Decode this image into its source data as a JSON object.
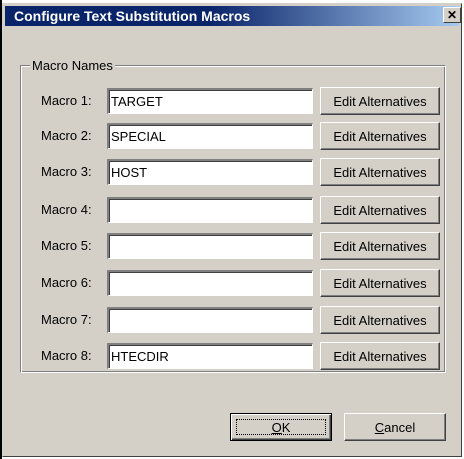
{
  "window": {
    "title": "Configure Text Substitution Macros",
    "close_glyph": "✕"
  },
  "group": {
    "label": "Macro Names"
  },
  "macros": [
    {
      "label": "Macro 1:",
      "value": "TARGET",
      "button": "Edit Alternatives"
    },
    {
      "label": "Macro 2:",
      "value": "SPECIAL",
      "button": "Edit Alternatives"
    },
    {
      "label": "Macro 3:",
      "value": "HOST",
      "button": "Edit Alternatives"
    },
    {
      "label": "Macro 4:",
      "value": "",
      "button": "Edit Alternatives"
    },
    {
      "label": "Macro 5:",
      "value": "",
      "button": "Edit Alternatives"
    },
    {
      "label": "Macro 6:",
      "value": "",
      "button": "Edit Alternatives"
    },
    {
      "label": "Macro 7:",
      "value": "",
      "button": "Edit Alternatives"
    },
    {
      "label": "Macro 8:",
      "value": "HTECDIR",
      "button": "Edit Alternatives"
    }
  ],
  "buttons": {
    "ok_accel": "O",
    "ok_rest": "K",
    "cancel_accel": "C",
    "cancel_rest": "ancel"
  },
  "colors": {
    "face": "#d4d0c8",
    "titlebar_start": "#0a246a",
    "titlebar_end": "#a6caf0"
  }
}
